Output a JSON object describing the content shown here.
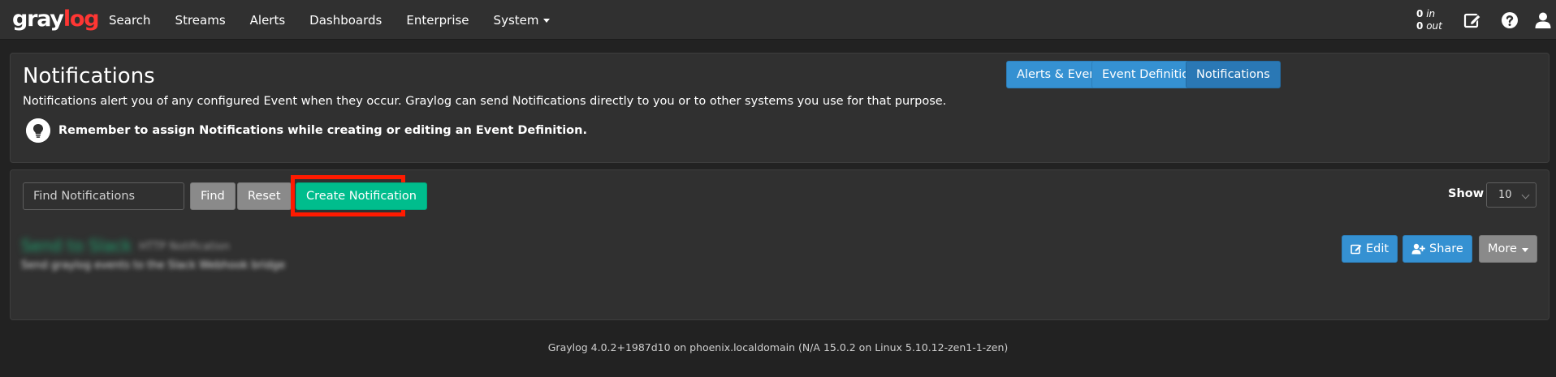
{
  "brand": {
    "part1": "gray",
    "part2": "log"
  },
  "nav": {
    "items": [
      {
        "label": "Search"
      },
      {
        "label": "Streams"
      },
      {
        "label": "Alerts"
      },
      {
        "label": "Dashboards"
      },
      {
        "label": "Enterprise"
      },
      {
        "label": "System"
      }
    ],
    "throughput": {
      "in_value": "0",
      "in_label": "in",
      "out_value": "0",
      "out_label": "out"
    },
    "icons": [
      "edit-icon",
      "help-icon",
      "user-icon"
    ]
  },
  "header": {
    "title": "Notifications",
    "description": "Notifications alert you of any configured Event when they occur. Graylog can send Notifications directly to you or to other systems you use for that purpose.",
    "tip": "Remember to assign Notifications while creating or editing an Event Definition.",
    "buttons": {
      "alerts_events": "Alerts & Events",
      "event_definitions": "Event Definitions",
      "notifications": "Notifications"
    }
  },
  "list": {
    "search_placeholder": "Find Notifications",
    "find_label": "Find",
    "reset_label": "Reset",
    "create_label": "Create Notification",
    "show_label": "Show",
    "page_size": "10",
    "items": [
      {
        "title": "Send to Slack",
        "type": "HTTP Notification",
        "description": "Send graylog events to the Slack Webhook bridge",
        "edit_label": "Edit",
        "share_label": "Share",
        "more_label": "More"
      }
    ]
  },
  "footer": {
    "text": "Graylog 4.0.2+1987d10 on phoenix.localdomain (N/A 15.0.2 on Linux 5.10.12-zen1-1-zen)"
  },
  "colors": {
    "navbar": "#303030",
    "background": "#222222",
    "brand_accent": "#ff3633",
    "primary": "#3591d2",
    "success": "#00bd8d",
    "default": "#8a8a8a",
    "highlight": "#ff1a00"
  }
}
